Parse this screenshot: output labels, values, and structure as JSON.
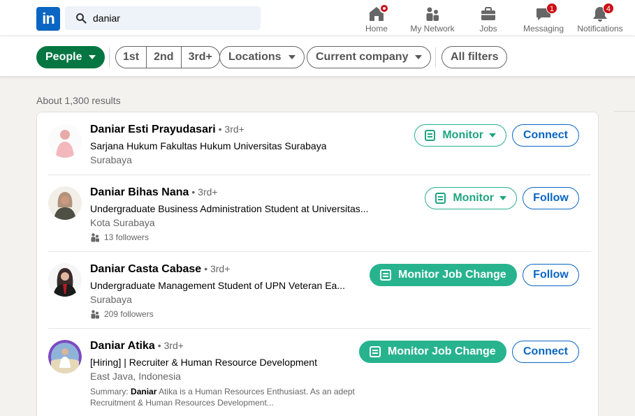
{
  "nav": {
    "logo_text": "in",
    "search_value": "daniar",
    "items": [
      {
        "label": "Home",
        "icon": "home-icon"
      },
      {
        "label": "My Network",
        "icon": "network-icon"
      },
      {
        "label": "Jobs",
        "icon": "briefcase-icon"
      },
      {
        "label": "Messaging",
        "icon": "messaging-icon",
        "badge": "1"
      },
      {
        "label": "Notifications",
        "icon": "bell-icon",
        "badge": "4"
      }
    ]
  },
  "filters": {
    "people": "People",
    "degrees": [
      "1st",
      "2nd",
      "3rd+"
    ],
    "locations": "Locations",
    "current_company": "Current company",
    "all_filters": "All filters"
  },
  "results_count": "About 1,300 results",
  "results": [
    {
      "name": "Daniar Esti Prayudasari",
      "degree": "• 3rd+",
      "headline": "Sarjana Hukum Fakultas Hukum Universitas Surabaya",
      "location": "Surabaya",
      "monitor_label": "Monitor",
      "action_label": "Connect"
    },
    {
      "name": "Daniar Bihas Nana",
      "degree": "• 3rd+",
      "headline": "Undergraduate Business Administration Student at Universitas...",
      "location": "Kota Surabaya",
      "followers": "13 followers",
      "monitor_label": "Monitor",
      "action_label": "Follow"
    },
    {
      "name": "Daniar Casta Cabase",
      "degree": "• 3rd+",
      "headline": "Undergraduate Management Student of UPN Veteran Ea...",
      "location": "Surabaya",
      "followers": "209 followers",
      "monitor_label": "Monitor Job Change",
      "action_label": "Follow"
    },
    {
      "name": "Daniar Atika",
      "degree": "• 3rd+",
      "headline": "[Hiring] | Recruiter & Human Resource Development",
      "location": "East Java, Indonesia",
      "summary_prefix": "Summary:",
      "summary_bold": "Daniar",
      "summary_rest": "Atika is a Human Resources Enthusiast. As an adept Recruitment & Human Resources Development...",
      "monitor_label": "Monitor Job Change",
      "action_label": "Connect"
    }
  ],
  "colors": {
    "brand": "#0a66c2",
    "people_filter": "#057642",
    "monitor": "#28b38f",
    "badge": "#cc1016"
  }
}
